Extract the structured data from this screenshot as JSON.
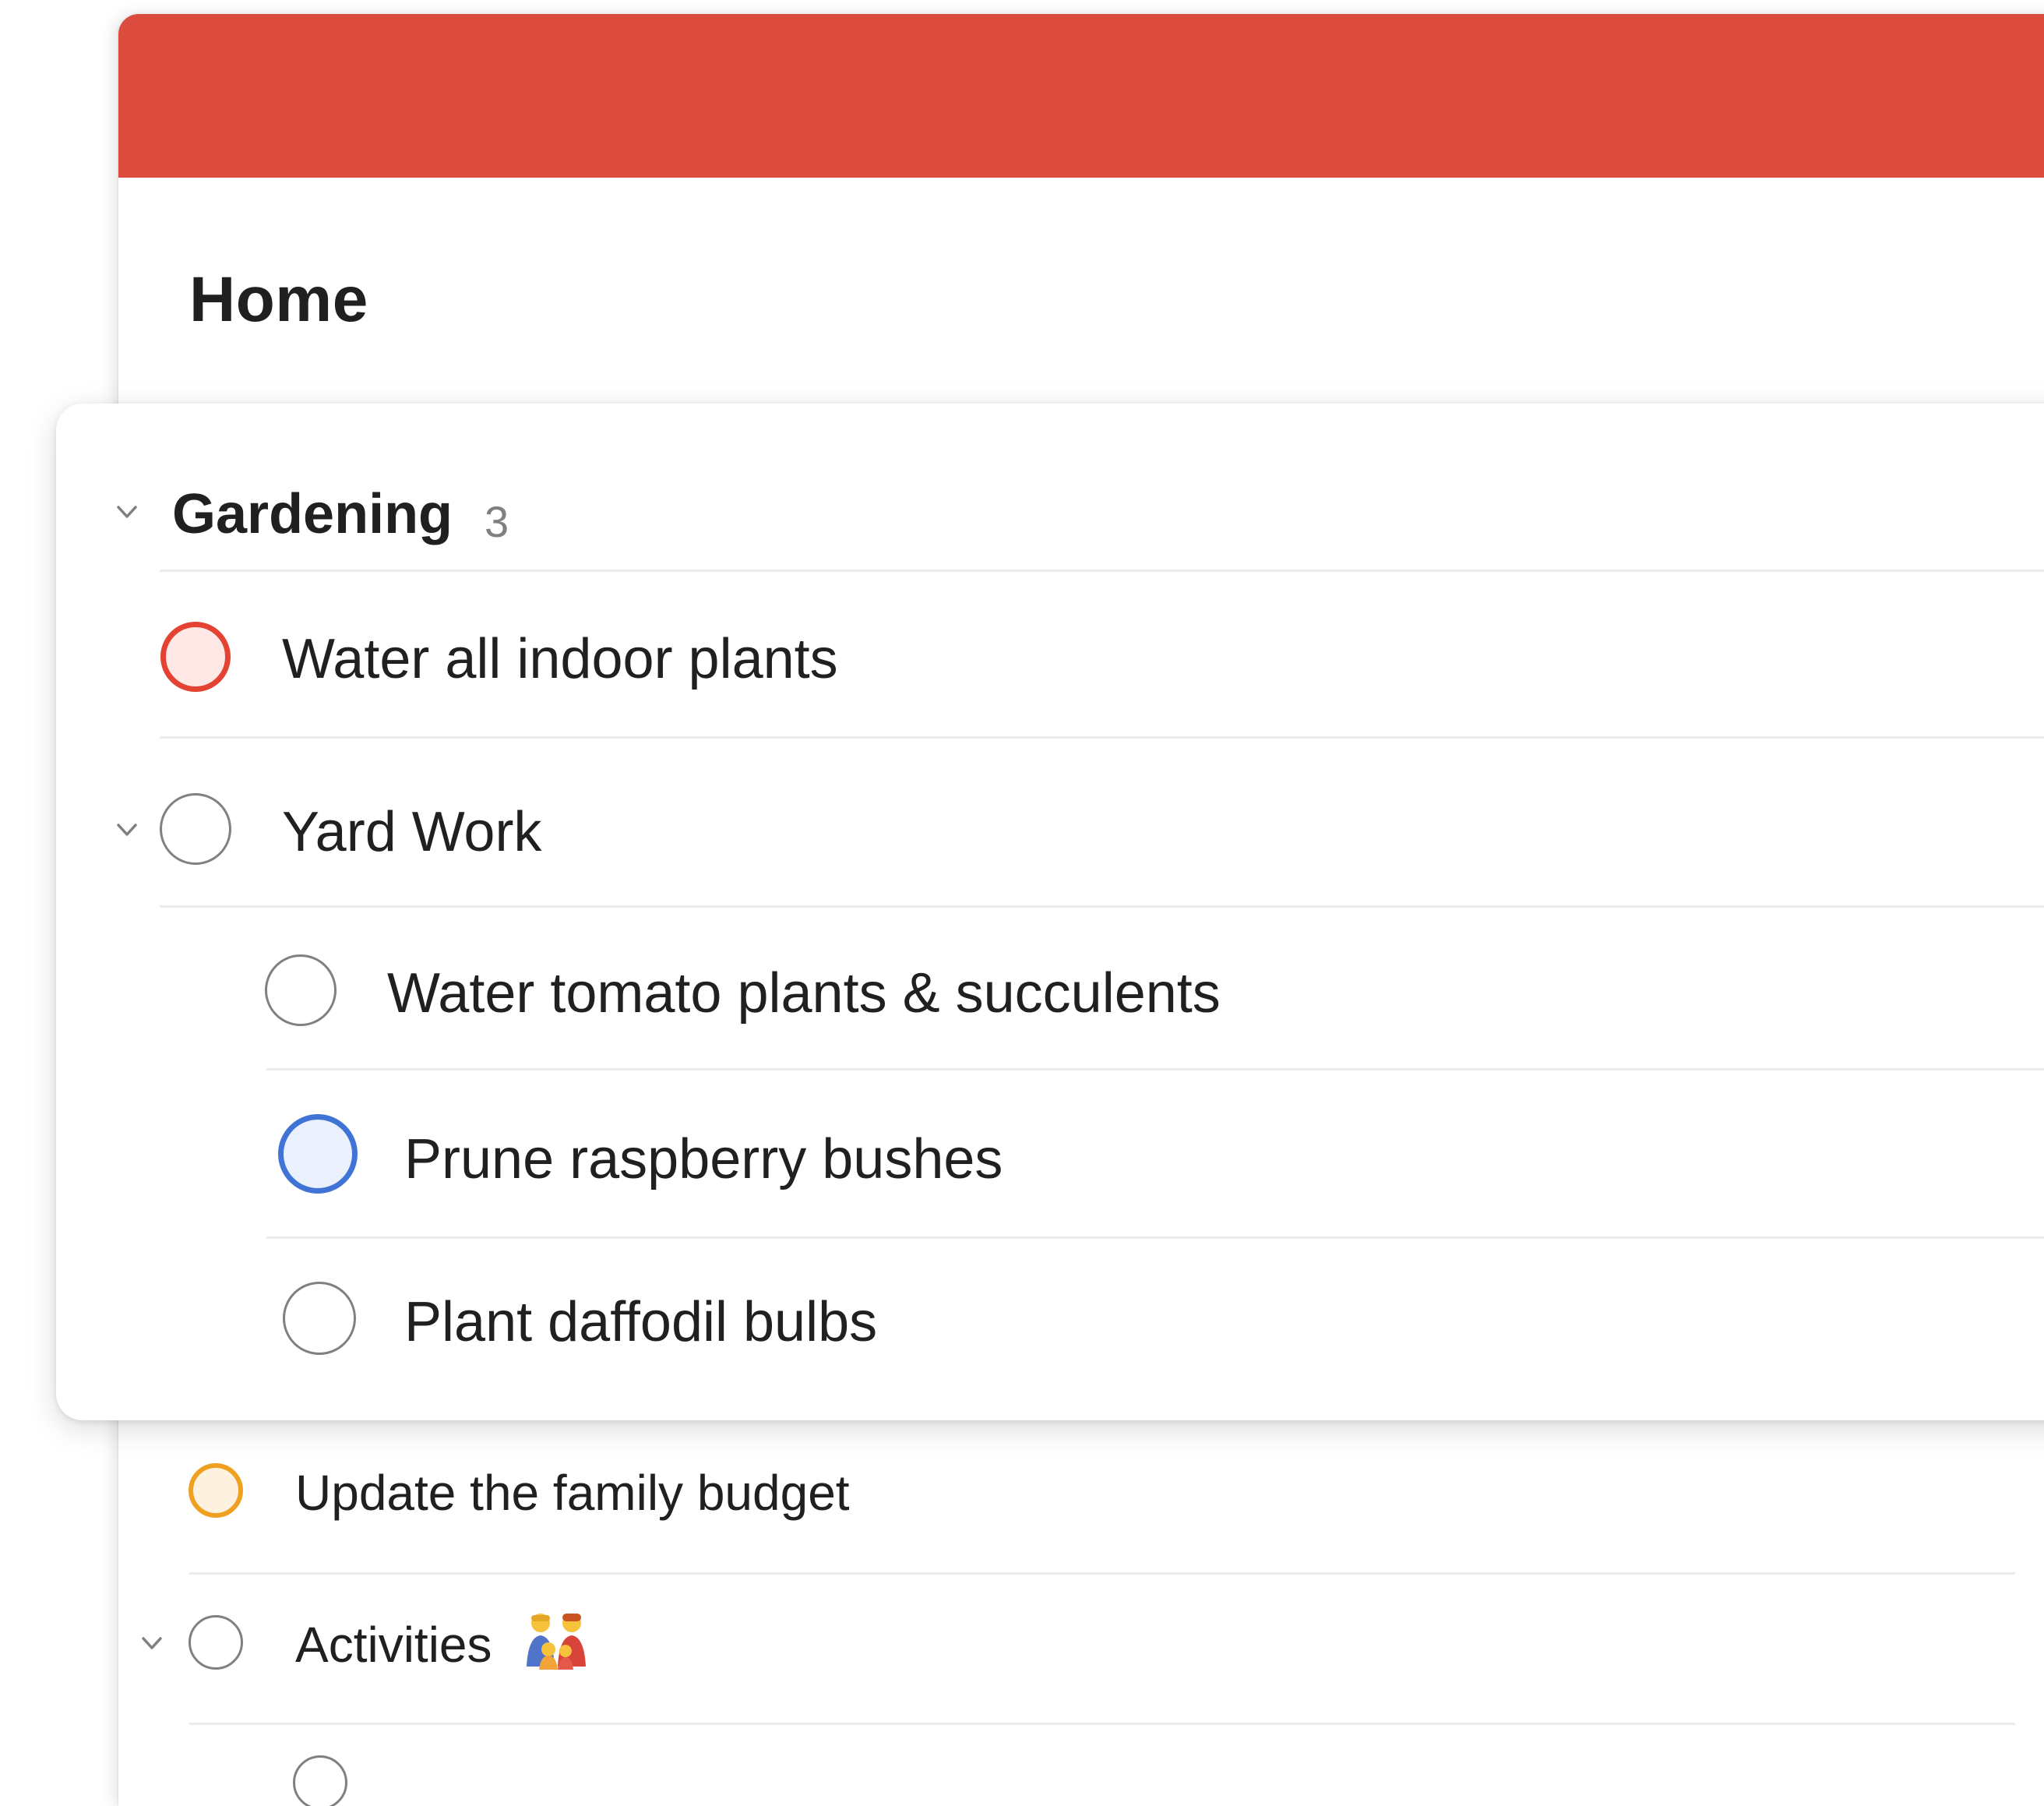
{
  "colors": {
    "accent": "#db4c3f",
    "priority1": "#e44232",
    "priority1_fill": "#fde8e6",
    "priority3": "#4073d6",
    "priority3_fill": "#eaf0fc",
    "priority2": "#f0a020",
    "priority2_fill": "#fdf2e0",
    "default_ring": "#808080"
  },
  "project": {
    "title": "Home"
  },
  "section": {
    "title": "Gardening",
    "count": "3",
    "collapse_icon": "chevron-down-icon",
    "tasks": [
      {
        "label": "Water all indoor plants",
        "priority": "p1"
      },
      {
        "label": "Yard Work",
        "priority": "none",
        "has_subtasks": true
      },
      {
        "label": "Water tomato plants & succulents",
        "priority": "none",
        "indent": 1
      },
      {
        "label": "Prune raspberry bushes",
        "priority": "p3",
        "indent": 1
      },
      {
        "label": "Plant daffodil bulbs",
        "priority": "none",
        "indent": 1
      }
    ]
  },
  "list": {
    "tasks": [
      {
        "label": "Update the family budget",
        "priority": "p2"
      },
      {
        "label": "Activities",
        "priority": "none",
        "has_subtasks": true,
        "emoji": "family-emoji-icon"
      }
    ]
  }
}
